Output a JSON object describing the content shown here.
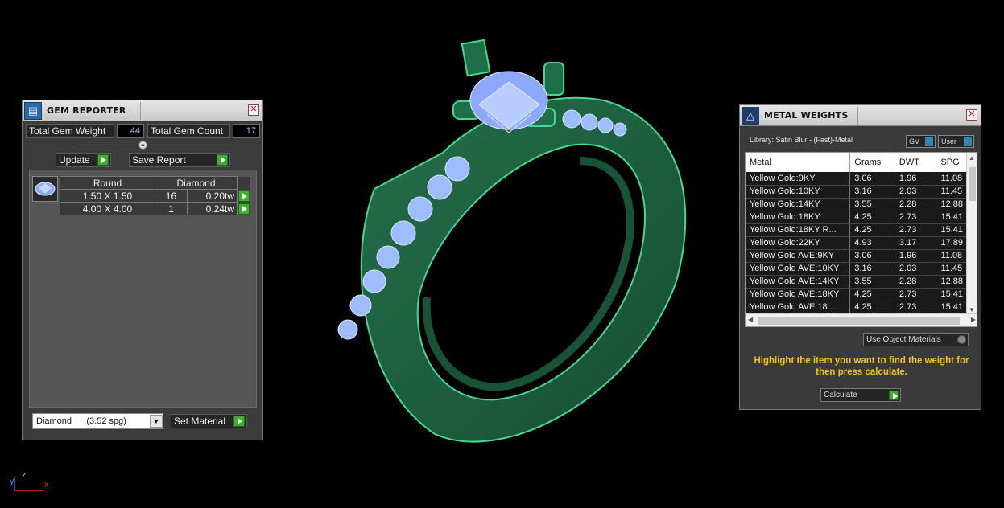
{
  "gem_reporter": {
    "title": "GEM REPORTER",
    "total_gem_weight_label": "Total Gem Weight",
    "total_gem_weight_value": ".44",
    "total_gem_count_label": "Total Gem Count",
    "total_gem_count_value": "17",
    "update_label": "Update",
    "save_report_label": "Save Report",
    "table_headers": [
      "Round",
      "Diamond"
    ],
    "rows": [
      {
        "size": "1.50 X 1.50",
        "count": "16",
        "weight": "0.20tw"
      },
      {
        "size": "4.00 X 4.00",
        "count": "1",
        "weight": "0.24tw"
      }
    ],
    "material_select": "Diamond      (3.52 spg)",
    "set_material_label": "Set Material"
  },
  "metal_weights": {
    "title": "METAL WEIGHTS",
    "library": "Library: Satin Blur - (Fast)-Metal",
    "toggle_gv": "GV",
    "toggle_user": "User",
    "columns": [
      "Metal",
      "Grams",
      "DWT",
      "SPG"
    ],
    "rows": [
      [
        "Yellow Gold:9KY",
        "3.06",
        "1.96",
        "11.08"
      ],
      [
        "Yellow Gold:10KY",
        "3.16",
        "2.03",
        "11.45"
      ],
      [
        "Yellow Gold:14KY",
        "3.55",
        "2.28",
        "12.88"
      ],
      [
        "Yellow Gold:18KY",
        "4.25",
        "2.73",
        "15.41"
      ],
      [
        "Yellow Gold:18KY R...",
        "4.25",
        "2.73",
        "15.41"
      ],
      [
        "Yellow Gold:22KY",
        "4.93",
        "3.17",
        "17.89"
      ],
      [
        "Yellow Gold AVE:9KY",
        "3.06",
        "1.96",
        "11.08"
      ],
      [
        "Yellow Gold AVE:10KY",
        "3.16",
        "2.03",
        "11.45"
      ],
      [
        "Yellow Gold AVE:14KY",
        "3.55",
        "2.28",
        "12.88"
      ],
      [
        "Yellow Gold AVE:18KY",
        "4.25",
        "2.73",
        "15.41"
      ],
      [
        "Yellow Gold AVE:18...",
        "4.25",
        "2.73",
        "15.41"
      ]
    ],
    "use_object_materials": "Use Object Materials",
    "message": "Highlight the item you want to find the weight for then press calculate.",
    "calculate_label": "Calculate"
  },
  "axis": {
    "y": "y",
    "z": "z",
    "x": "x"
  },
  "colors": {
    "ring": "#1f6e4a",
    "ring_edge": "#3fd08a",
    "gem": "#8fb4ff",
    "accent_play": "#3fae2f",
    "message": "#f0c020"
  }
}
